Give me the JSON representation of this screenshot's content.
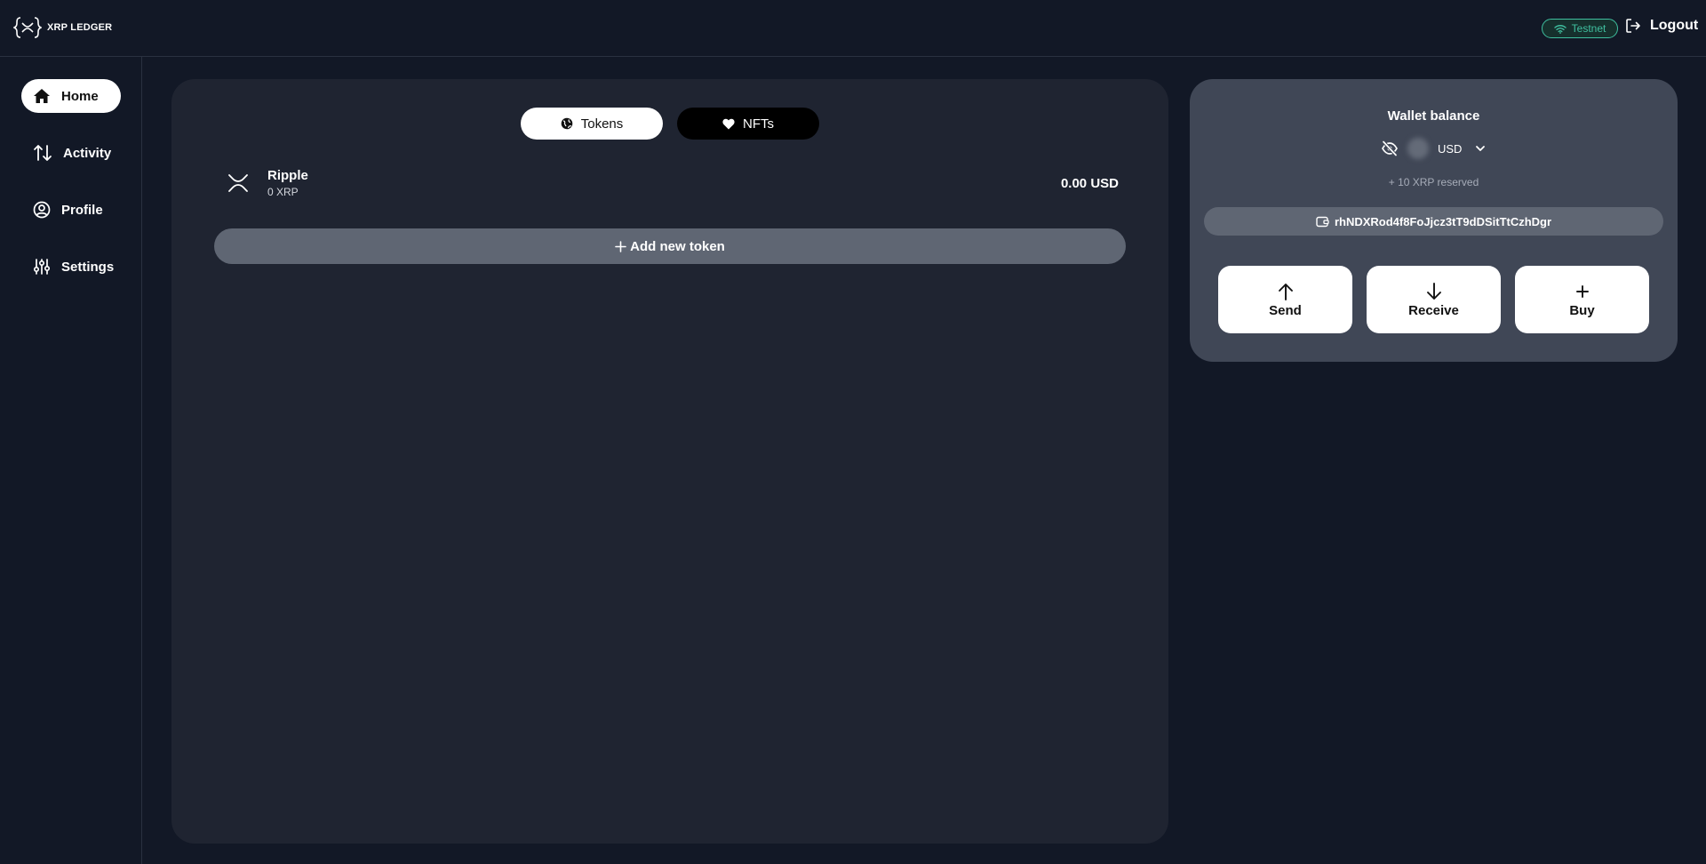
{
  "header": {
    "logo_text": "XRP LEDGER",
    "network_label": "Testnet",
    "logout_label": "Logout"
  },
  "sidebar": {
    "items": [
      {
        "label": "Home",
        "icon": "home-icon",
        "active": true
      },
      {
        "label": "Activity",
        "icon": "arrows-updown-icon",
        "active": false
      },
      {
        "label": "Profile",
        "icon": "user-circle-icon",
        "active": false
      },
      {
        "label": "Settings",
        "icon": "sliders-icon",
        "active": false
      }
    ]
  },
  "main": {
    "tabs": [
      {
        "label": "Tokens",
        "icon": "globe-icon",
        "active": true
      },
      {
        "label": "NFTs",
        "icon": "heart-icon",
        "active": false
      }
    ],
    "tokens": [
      {
        "name": "Ripple",
        "amount": "0 XRP",
        "value": "0.00 USD"
      }
    ],
    "add_token_label": "Add new token"
  },
  "wallet": {
    "title": "Wallet balance",
    "currency": "USD",
    "reserved": "+ 10 XRP reserved",
    "address": "rhNDXRod4f8FoJjcz3tT9dDSitTtCzhDgr",
    "actions": [
      {
        "label": "Send",
        "icon": "arrow-up-icon"
      },
      {
        "label": "Receive",
        "icon": "arrow-down-icon"
      },
      {
        "label": "Buy",
        "icon": "plus-icon"
      }
    ]
  },
  "colors": {
    "background": "#121826",
    "panel": "#1f2431",
    "wallet_panel": "#404756",
    "pill": "#5f6673",
    "network_accent": "#3fbf9f"
  }
}
